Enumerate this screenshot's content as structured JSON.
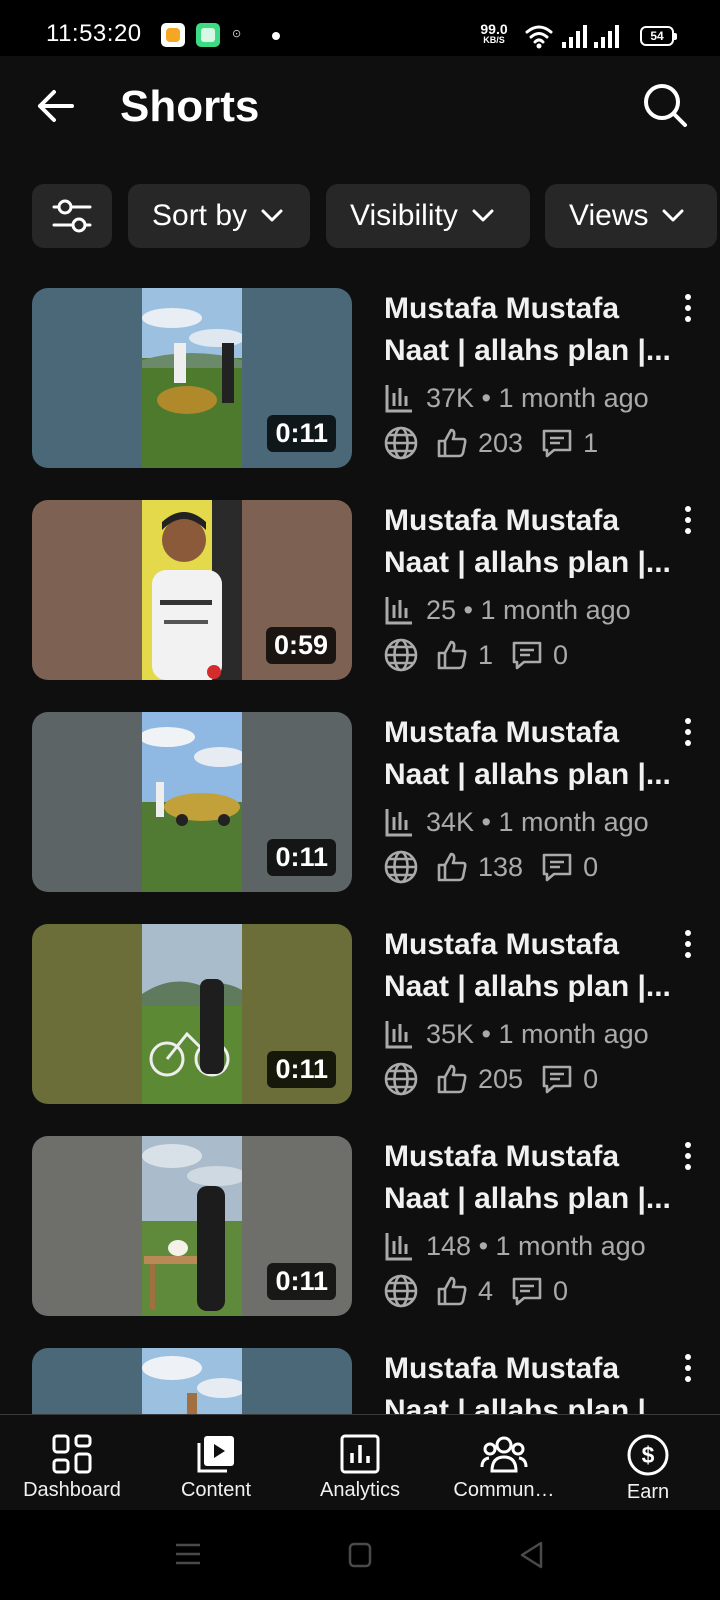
{
  "status_bar": {
    "time": "11:53:20",
    "net_speed_value": "99.0",
    "net_speed_unit": "KB/S",
    "battery": "54",
    "app_icons": [
      "orange-app-icon",
      "green-app-icon",
      "circle-app-icon"
    ]
  },
  "header": {
    "title": "Shorts"
  },
  "filters": {
    "sort_label": "Sort by",
    "visibility_label": "Visibility",
    "views_label": "Views"
  },
  "videos": [
    {
      "title": "Mustafa Mustafa\nNaat | allahs plan |...",
      "views": "37K",
      "age": "1 month ago",
      "likes": "203",
      "comments": "1",
      "duration": "0:11",
      "visibility": "public",
      "bg_color": "#4a6878"
    },
    {
      "title": "Mustafa Mustafa\nNaat | allahs plan |...",
      "views": "25",
      "age": "1 month ago",
      "likes": "1",
      "comments": "0",
      "duration": "0:59",
      "visibility": "public",
      "bg_color": "#7d6253"
    },
    {
      "title": "Mustafa Mustafa\nNaat | allahs plan |...",
      "views": "34K",
      "age": "1 month ago",
      "likes": "138",
      "comments": "0",
      "duration": "0:11",
      "visibility": "public",
      "bg_color": "#5d6466"
    },
    {
      "title": "Mustafa Mustafa\nNaat | allahs plan |...",
      "views": "35K",
      "age": "1 month ago",
      "likes": "205",
      "comments": "0",
      "duration": "0:11",
      "visibility": "public",
      "bg_color": "#6b6e38"
    },
    {
      "title": "Mustafa Mustafa\nNaat | allahs plan |...",
      "views": "148",
      "age": "1 month ago",
      "likes": "4",
      "comments": "0",
      "duration": "0:11",
      "visibility": "public",
      "bg_color": "#6e6e6a"
    },
    {
      "title": "Mustafa Mustafa\nNaat | allahs plan |",
      "bg_color": "#4a6878"
    }
  ],
  "bottom_nav": [
    {
      "label": "Dashboard",
      "icon": "dashboard-icon"
    },
    {
      "label": "Content",
      "icon": "content-icon"
    },
    {
      "label": "Analytics",
      "icon": "analytics-icon"
    },
    {
      "label": "Commun…",
      "icon": "community-icon"
    },
    {
      "label": "Earn",
      "icon": "earn-icon"
    }
  ],
  "colors": {
    "background": "#0f0f0f",
    "chip_background": "#272727",
    "secondary_text": "#aaaaaa"
  }
}
